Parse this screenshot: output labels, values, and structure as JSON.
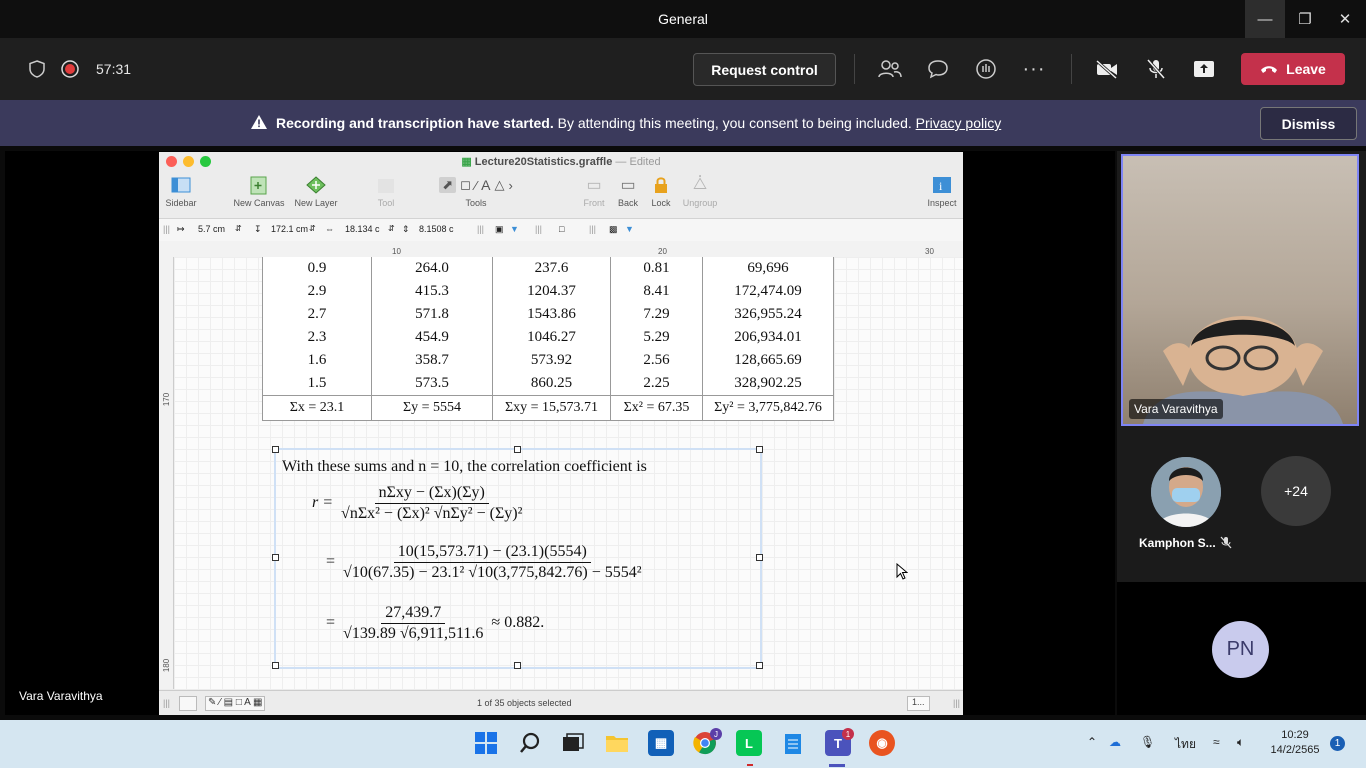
{
  "window": {
    "title": "General",
    "minimize_icon": "minimize-icon",
    "maximize_icon": "restore-icon",
    "close_icon": "close-icon"
  },
  "meeting_bar": {
    "timer": "57:31",
    "request_control_label": "Request control",
    "leave_label": "Leave",
    "icons": [
      "shield-icon",
      "record-icon",
      "people-icon",
      "chat-icon",
      "raise-hand-icon",
      "more-icon",
      "camera-off-icon",
      "mic-off-icon",
      "share-icon",
      "phone-icon"
    ]
  },
  "banner": {
    "bold": "Recording and transcription have started.",
    "text": "By attending this meeting, you consent to being included.",
    "link": "Privacy policy",
    "dismiss_label": "Dismiss"
  },
  "shared_app": {
    "file_name": "Lecture20Statistics.graffle",
    "edited": "— Edited",
    "toolbar": [
      {
        "label": "Sidebar",
        "icon": "sidebar-icon"
      },
      {
        "label": "New Canvas",
        "icon": "new-canvas-icon"
      },
      {
        "label": "New Layer",
        "icon": "new-layer-icon"
      },
      {
        "label": "Tool",
        "icon": "tool-icon"
      },
      {
        "label": "Tools",
        "icon": "tools-icon"
      },
      {
        "label": "Front",
        "icon": "front-icon"
      },
      {
        "label": "Back",
        "icon": "back-icon"
      },
      {
        "label": "Lock",
        "icon": "lock-icon"
      },
      {
        "label": "Ungroup",
        "icon": "ungroup-icon"
      },
      {
        "label": "Inspect",
        "icon": "inspect-icon"
      }
    ],
    "inspector": {
      "x": "5.7 cm",
      "y": "172.1 cm",
      "w": "18.134 c",
      "h": "8.1508 c"
    },
    "ruler_ticks": [
      "10",
      "20",
      "30"
    ],
    "vruler_ticks": [
      "170",
      "180"
    ],
    "status": "1 of 35 objects selected",
    "zoom": "1..."
  },
  "table": {
    "rows": [
      [
        "0.9",
        "264.0",
        "237.6",
        "0.81",
        "69,696"
      ],
      [
        "2.9",
        "415.3",
        "1204.37",
        "8.41",
        "172,474.09"
      ],
      [
        "2.7",
        "571.8",
        "1543.86",
        "7.29",
        "326,955.24"
      ],
      [
        "2.3",
        "454.9",
        "1046.27",
        "5.29",
        "206,934.01"
      ],
      [
        "1.6",
        "358.7",
        "573.92",
        "2.56",
        "128,665.69"
      ],
      [
        "1.5",
        "573.5",
        "860.25",
        "2.25",
        "328,902.25"
      ]
    ],
    "sums": [
      "Σx = 23.1",
      "Σy = 5554",
      "Σxy = 15,573.71",
      "Σx² = 67.35",
      "Σy² = 3,775,842.76"
    ]
  },
  "formula": {
    "intro": "With these sums and n = 10, the correlation coefficient is",
    "r_label": "r =",
    "line1_num": "nΣxy − (Σx)(Σy)",
    "line1_den": "√nΣx² − (Σx)² √nΣy² − (Σy)²",
    "line2_num": "10(15,573.71) − (23.1)(5554)",
    "line2_den": "√10(67.35) − 23.1² √10(3,775,842.76) − 5554²",
    "line3_num": "27,439.7",
    "line3_den": "√139.89 √6,911,511.6",
    "result": "≈ 0.882."
  },
  "stage": {
    "presenter_label": "Vara Varavithya"
  },
  "participants": {
    "main_name": "Vara Varavithya",
    "second_name": "Kamphon S...",
    "overflow": "+24",
    "initials": "PN"
  },
  "taskbar": {
    "time": "10:29",
    "date": "14/2/2565",
    "lang": "ไทย",
    "notifications": "1",
    "teams_badge": "1",
    "chrome_badge": "J"
  }
}
